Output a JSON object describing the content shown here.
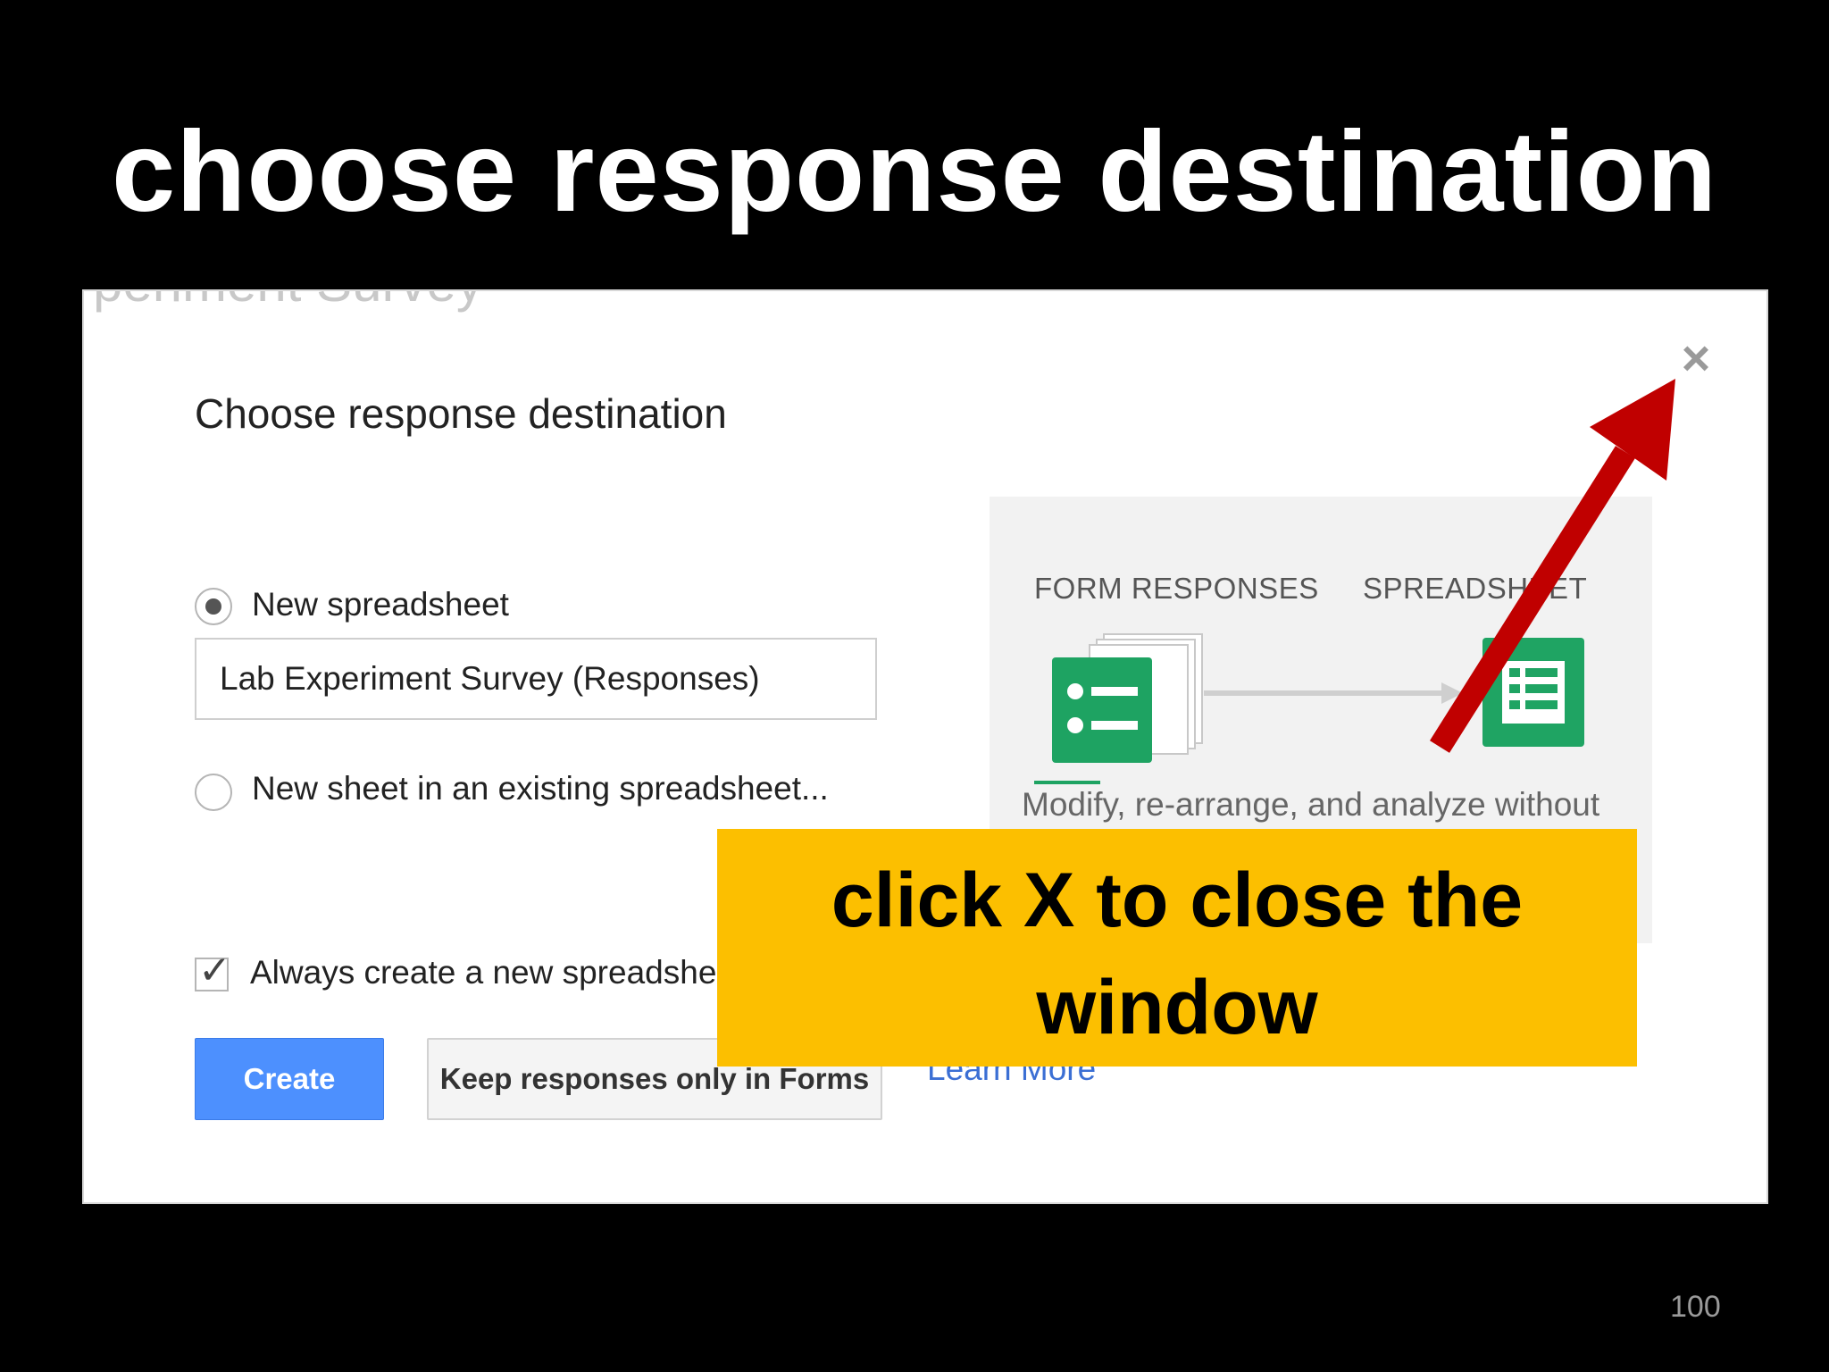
{
  "slide": {
    "title": "choose response destination",
    "page_number": "100"
  },
  "dialog": {
    "ghost_text": "periment Survey",
    "title": "Choose response destination",
    "close_icon": "close-icon",
    "options": {
      "new_spreadsheet": "New spreadsheet",
      "existing_spreadsheet": "New sheet in an existing spreadsheet..."
    },
    "spreadsheet_name": "Lab Experiment Survey (Responses)",
    "always_create": "Always create a new spreadsheet",
    "buttons": {
      "create": "Create",
      "keep": "Keep responses only in Forms"
    },
    "learn_more": "Learn More",
    "panel": {
      "form_label": "FORM RESPONSES",
      "sheet_label": "SPREADSHEET",
      "description": "Modify, re-arrange, and analyze without"
    }
  },
  "callout": {
    "line1": "click X to close the",
    "line2": "window"
  },
  "colors": {
    "background": "#000000",
    "callout": "#fcbf00",
    "arrow": "#c00000",
    "create_button": "#4d90fe",
    "forms_green": "#1ea362",
    "sheets_green": "#1fa463"
  }
}
